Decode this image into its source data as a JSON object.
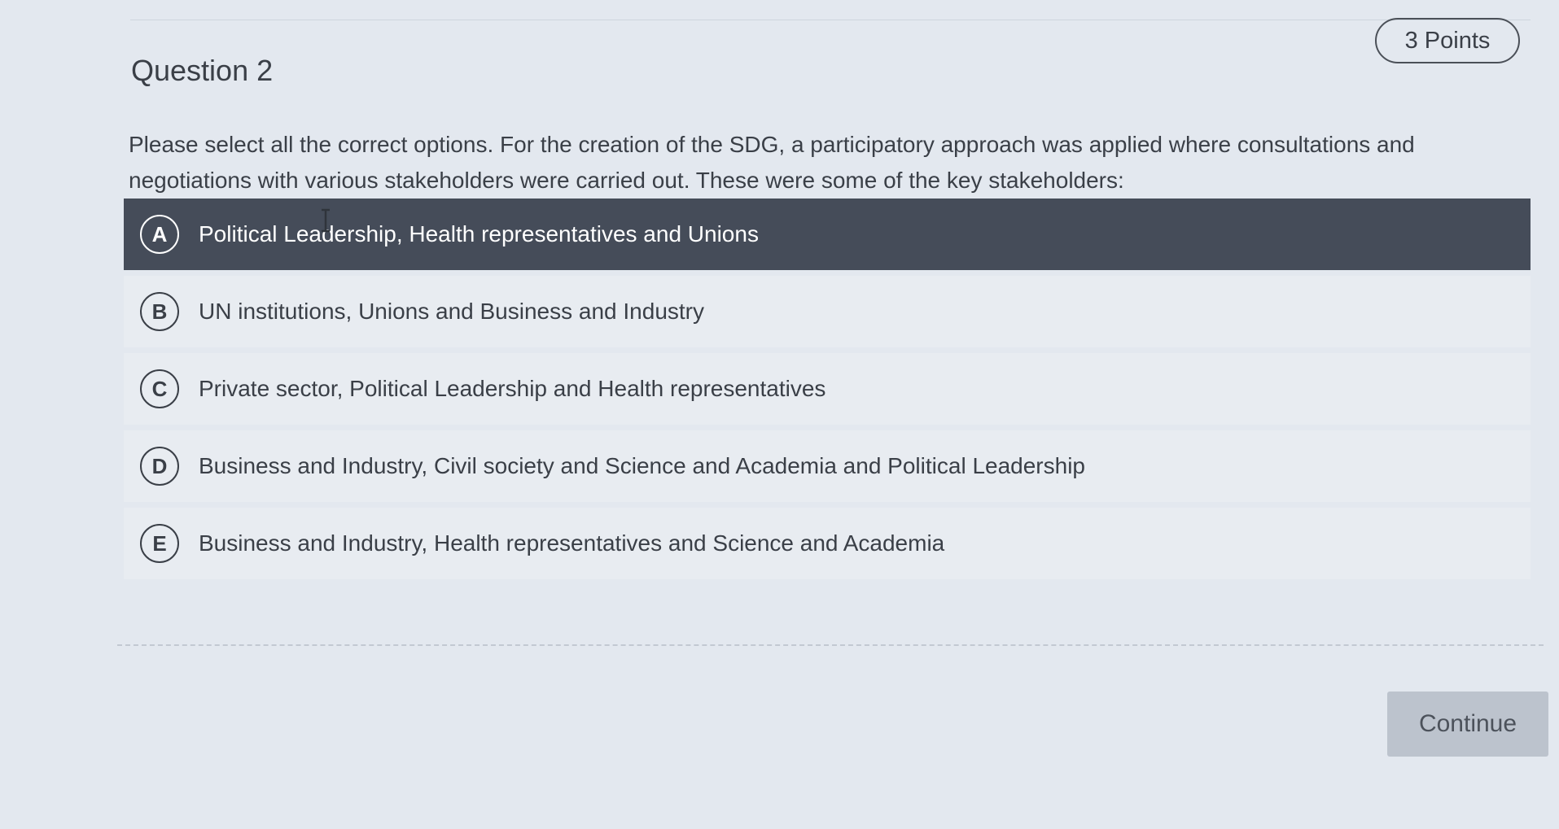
{
  "question": {
    "title": "Question 2",
    "points": "3 Points",
    "prompt": "Please select all the correct options. For the creation of the SDG, a participatory approach was applied where consultations and negotiations with various stakeholders were carried out. These were some of the key stakeholders:"
  },
  "options": [
    {
      "letter": "A",
      "text": "Political Leadership, Health representatives and Unions",
      "selected": true
    },
    {
      "letter": "B",
      "text": "UN institutions, Unions and Business and Industry",
      "selected": false
    },
    {
      "letter": "C",
      "text": "Private sector, Political Leadership and Health representatives",
      "selected": false
    },
    {
      "letter": "D",
      "text": "Business and Industry, Civil society and Science and Academia and Political Leadership",
      "selected": false
    },
    {
      "letter": "E",
      "text": "Business and Industry, Health representatives and Science and Academia",
      "selected": false
    }
  ],
  "footer": {
    "continue_label": "Continue"
  },
  "colors": {
    "selected_background": "#454c59",
    "option_background": "#e8ecf1",
    "page_background": "#e3e8ef",
    "button_background": "#bcc3cd"
  },
  "icons": {
    "cursor": "text-cursor-icon"
  }
}
